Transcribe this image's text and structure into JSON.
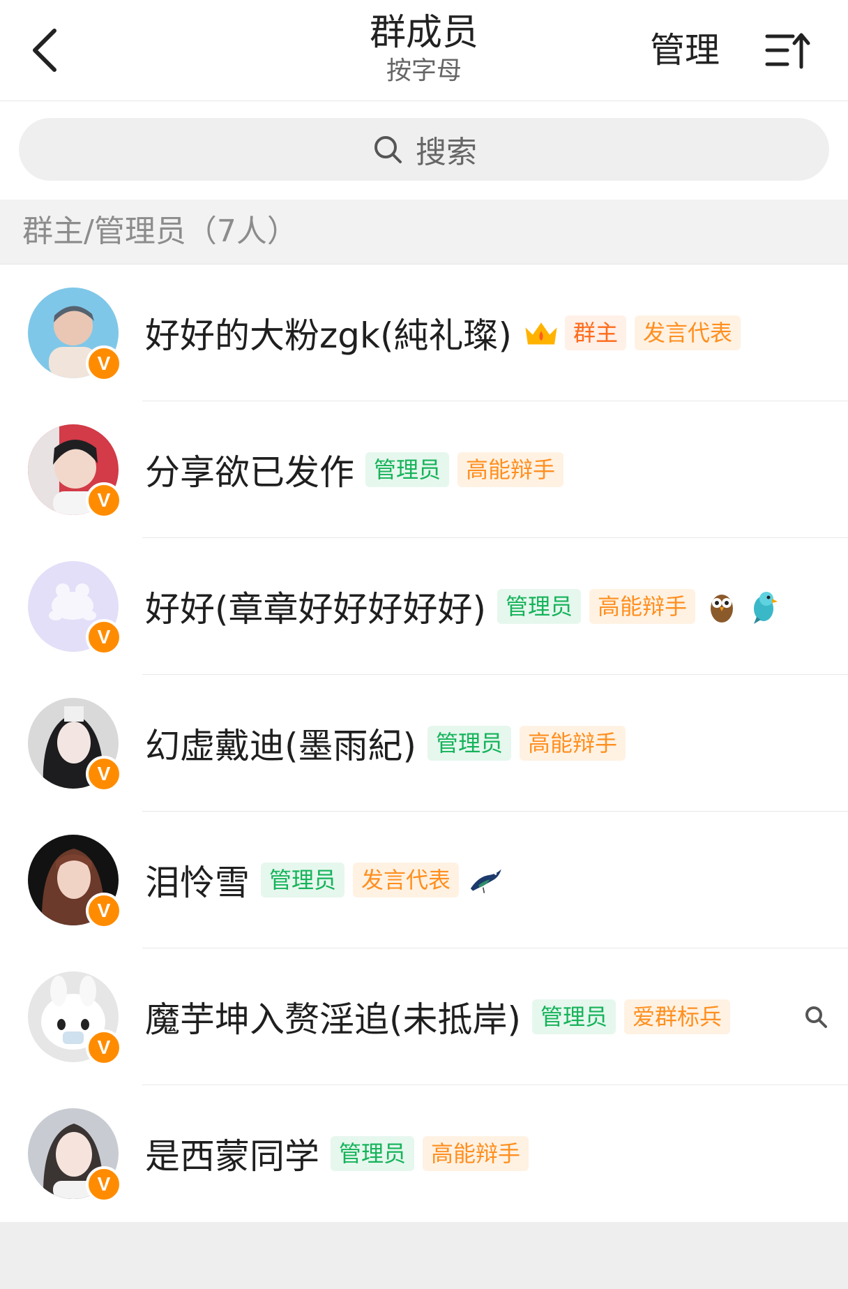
{
  "header": {
    "title": "群成员",
    "subtitle": "按字母",
    "manage_label": "管理",
    "back_icon": "chevron-left-icon",
    "sort_icon": "sort-ascending-icon"
  },
  "search": {
    "placeholder": "搜索",
    "icon": "search-icon"
  },
  "section": {
    "label": "群主/管理员（7人）"
  },
  "colors": {
    "green_tag": "#16b35a",
    "orange_tag": "#ff8f1f",
    "verified_badge": "#ff8c00"
  },
  "members": [
    {
      "name": "好好的大粉zgk(純礼璨)",
      "verified_badge": "V",
      "tags": [
        {
          "label": "群主",
          "style": "red"
        },
        {
          "label": "发言代表",
          "style": "orange"
        }
      ],
      "extra_icons": [
        "crown-icon"
      ]
    },
    {
      "name": "分享欲已发作",
      "verified_badge": "V",
      "tags": [
        {
          "label": "管理员",
          "style": "green"
        },
        {
          "label": "高能辩手",
          "style": "orange"
        }
      ]
    },
    {
      "name": "好好(章章好好好好好)",
      "verified_badge": "V",
      "tags": [
        {
          "label": "管理员",
          "style": "green"
        },
        {
          "label": "高能辩手",
          "style": "orange"
        }
      ],
      "trailing_icons": [
        "owl-icon",
        "parrot-icon"
      ]
    },
    {
      "name": "幻虚戴迪(墨雨紀)",
      "verified_badge": "V",
      "tags": [
        {
          "label": "管理员",
          "style": "green"
        },
        {
          "label": "高能辩手",
          "style": "orange"
        }
      ]
    },
    {
      "name": "泪怜雪",
      "verified_badge": "V",
      "tags": [
        {
          "label": "管理员",
          "style": "green"
        },
        {
          "label": "发言代表",
          "style": "orange"
        }
      ],
      "trailing_icons": [
        "magpie-icon"
      ]
    },
    {
      "name": "魔芋坤入赘淫追(未抵岸)",
      "verified_badge": "V",
      "tags": [
        {
          "label": "管理员",
          "style": "green"
        },
        {
          "label": "爱群标兵",
          "style": "orange"
        }
      ],
      "row_action_icon": "search-icon"
    },
    {
      "name": "是西蒙同学",
      "verified_badge": "V",
      "tags": [
        {
          "label": "管理员",
          "style": "green"
        },
        {
          "label": "高能辩手",
          "style": "orange"
        }
      ]
    }
  ]
}
